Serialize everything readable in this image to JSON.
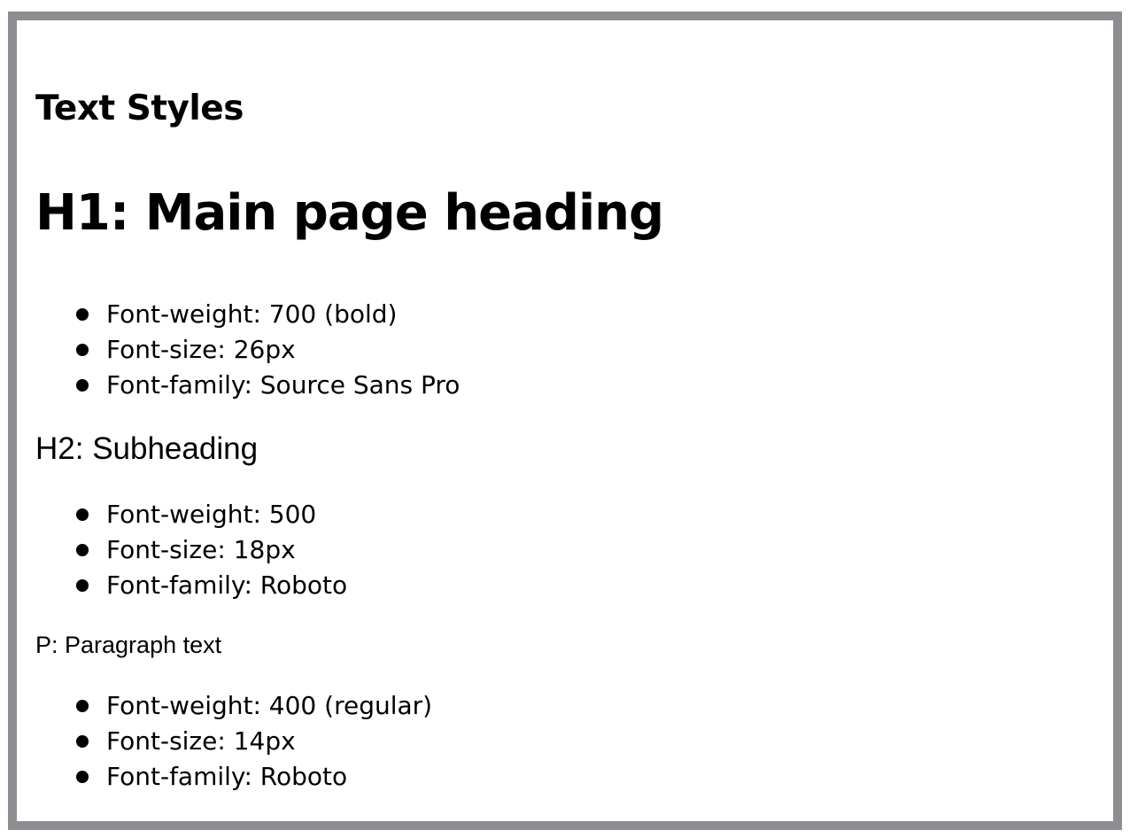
{
  "page": {
    "title": "Text Styles"
  },
  "styles": [
    {
      "sample": "H1: Main page heading",
      "specs": [
        "Font-weight: 700 (bold)",
        "Font-size: 26px",
        "Font-family: Source Sans Pro"
      ]
    },
    {
      "sample": "H2: Subheading",
      "specs": [
        "Font-weight: 500",
        "Font-size: 18px",
        "Font-family: Roboto"
      ]
    },
    {
      "sample": "P: Paragraph text",
      "specs": [
        "Font-weight: 400 (regular)",
        "Font-size: 14px",
        "Font-family: Roboto"
      ]
    }
  ],
  "colors": {
    "border": "#8e8e92",
    "background": "#ffffff",
    "text": "#000000"
  }
}
